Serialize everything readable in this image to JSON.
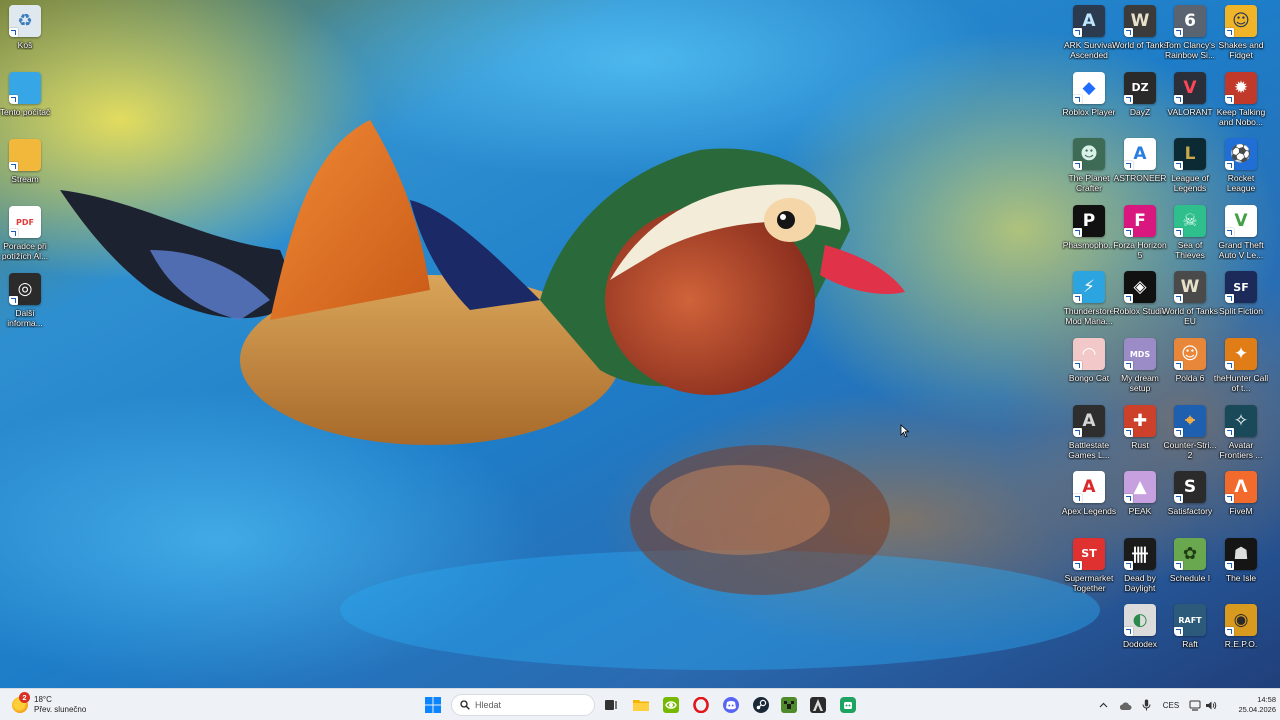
{
  "desktop": {
    "left_icons": [
      {
        "id": "recycle-bin",
        "label": "Koš",
        "icon": "recycle-bin-icon",
        "bg": "#dfe8ee",
        "glyph": "♻",
        "fg": "#3b7bbf"
      },
      {
        "id": "this-pc",
        "label": "Tento počítač",
        "icon": "monitor-icon",
        "bg": "#37a6e6",
        "glyph": "",
        "fg": "#ffffff"
      },
      {
        "id": "stream",
        "label": "Stream",
        "icon": "folder-icon",
        "bg": "#f1b83b",
        "glyph": "",
        "fg": "#ffffff"
      },
      {
        "id": "pdf",
        "label": "Poradce při potížích Al...",
        "icon": "pdf-icon",
        "bg": "#ffffff",
        "glyph": "PDF",
        "fg": "#e23c3c"
      },
      {
        "id": "more-info",
        "label": "Další informa...",
        "icon": "chrome-icon",
        "bg": "#2b2b2b",
        "glyph": "◎",
        "fg": "#ffffff"
      }
    ],
    "grid_icons": [
      {
        "id": "ark",
        "label": "ARK Survival Ascended",
        "icon": "ark-icon",
        "bg": "#2c3a4f",
        "glyph": "A",
        "fg": "#bde6ff"
      },
      {
        "id": "wot",
        "label": "World of Tanks",
        "icon": "world-of-tanks-icon",
        "bg": "#3b3b3b",
        "glyph": "W",
        "fg": "#e8e0c8"
      },
      {
        "id": "rainbow",
        "label": "Tom Clancy's Rainbow Si...",
        "icon": "rainbow-six-icon",
        "bg": "#5a6470",
        "glyph": "6",
        "fg": "#ffffff"
      },
      {
        "id": "shakes",
        "label": "Shakes and Fidget",
        "icon": "shakes-fidget-icon",
        "bg": "#f0b428",
        "glyph": "☺",
        "fg": "#20345a"
      },
      {
        "id": "roblox-player",
        "label": "Roblox Player",
        "icon": "roblox-player-icon",
        "bg": "#ffffff",
        "glyph": "◆",
        "fg": "#1f6cff"
      },
      {
        "id": "dayz",
        "label": "DayZ",
        "icon": "dayz-icon",
        "bg": "#2a2a2a",
        "glyph": "DZ",
        "fg": "#ffffff"
      },
      {
        "id": "valorant",
        "label": "VALORANT",
        "icon": "valorant-icon",
        "bg": "#2b2f3a",
        "glyph": "V",
        "fg": "#ff4655"
      },
      {
        "id": "ktane",
        "label": "Keep Talking and Nobo...",
        "icon": "keep-talking-icon",
        "bg": "#c0392b",
        "glyph": "✹",
        "fg": "#ffffff"
      },
      {
        "id": "planet-crafter",
        "label": "The Planet Crafter",
        "icon": "planet-crafter-icon",
        "bg": "#3d6b55",
        "glyph": "☻",
        "fg": "#d9f0e8"
      },
      {
        "id": "astroneer",
        "label": "ASTRONEER",
        "icon": "astroneer-icon",
        "bg": "#ffffff",
        "glyph": "A",
        "fg": "#2a7de1"
      },
      {
        "id": "lol",
        "label": "League of Legends",
        "icon": "league-of-legends-icon",
        "bg": "#0b2a33",
        "glyph": "L",
        "fg": "#c8a84b"
      },
      {
        "id": "rocket",
        "label": "Rocket League",
        "icon": "rocket-league-icon",
        "bg": "#1f6fd6",
        "glyph": "⚽",
        "fg": "#ffffff"
      },
      {
        "id": "phasmo",
        "label": "Phasmopho...",
        "icon": "phasmophobia-icon",
        "bg": "#111111",
        "glyph": "P",
        "fg": "#ffffff"
      },
      {
        "id": "forza",
        "label": "Forza Horizon 5",
        "icon": "forza-icon",
        "bg": "#d8187e",
        "glyph": "F",
        "fg": "#ffffff"
      },
      {
        "id": "sea",
        "label": "Sea of Thieves",
        "icon": "sea-of-thieves-icon",
        "bg": "#2fbf8c",
        "glyph": "☠",
        "fg": "#e8fff4"
      },
      {
        "id": "gta",
        "label": "Grand Theft Auto V Le...",
        "icon": "gta-icon",
        "bg": "#ffffff",
        "glyph": "V",
        "fg": "#43a047"
      },
      {
        "id": "thunderstore",
        "label": "Thunderstore Mod Mana...",
        "icon": "thunderstore-icon",
        "bg": "#2ca4e0",
        "glyph": "⚡",
        "fg": "#ffffff"
      },
      {
        "id": "roblox-studio",
        "label": "Roblox Studio",
        "icon": "roblox-studio-icon",
        "bg": "#111111",
        "glyph": "◈",
        "fg": "#ffffff"
      },
      {
        "id": "wot-eu",
        "label": "World of Tanks EU",
        "icon": "world-of-tanks-eu-icon",
        "bg": "#4a4a4a",
        "glyph": "W",
        "fg": "#e8e0c8"
      },
      {
        "id": "split",
        "label": "Split Fiction",
        "icon": "split-fiction-icon",
        "bg": "#1c2a5a",
        "glyph": "SF",
        "fg": "#ffffff"
      },
      {
        "id": "bongo",
        "label": "Bongo Cat",
        "icon": "bongo-cat-icon",
        "bg": "#f3c8c8",
        "glyph": "◠",
        "fg": "#ffffff"
      },
      {
        "id": "mds",
        "label": "My dream setup",
        "icon": "my-dream-setup-icon",
        "bg": "#9b8cc8",
        "glyph": "MDS",
        "fg": "#ffffff"
      },
      {
        "id": "polda",
        "label": "Polda 6",
        "icon": "polda-icon",
        "bg": "#e8873a",
        "glyph": "☺",
        "fg": "#ffffff"
      },
      {
        "id": "thehunter",
        "label": "theHunter Call of t...",
        "icon": "thehunter-icon",
        "bg": "#e07d17",
        "glyph": "✦",
        "fg": "#ffffff"
      },
      {
        "id": "battlestate",
        "label": "Battlestate Games L...",
        "icon": "battlestate-icon",
        "bg": "#2e2e2e",
        "glyph": "A",
        "fg": "#d6d6d6"
      },
      {
        "id": "rust",
        "label": "Rust",
        "icon": "rust-icon",
        "bg": "#cd412b",
        "glyph": "✚",
        "fg": "#ffffff"
      },
      {
        "id": "cs2",
        "label": "Counter-Stri... 2",
        "icon": "counter-strike-icon",
        "bg": "#1f5fb0",
        "glyph": "⌖",
        "fg": "#ffb13b"
      },
      {
        "id": "avatar",
        "label": "Avatar Frontiers ...",
        "icon": "avatar-frontiers-icon",
        "bg": "#1a4a5a",
        "glyph": "✧",
        "fg": "#ffffff"
      },
      {
        "id": "apex",
        "label": "Apex Legends",
        "icon": "apex-icon",
        "bg": "#ffffff",
        "glyph": "A",
        "fg": "#da292a"
      },
      {
        "id": "peak",
        "label": "PEAK",
        "icon": "peak-icon",
        "bg": "#c7a0e0",
        "glyph": "▲",
        "fg": "#ffffff"
      },
      {
        "id": "satisfactory",
        "label": "Satisfactory",
        "icon": "satisfactory-icon",
        "bg": "#2b2b2b",
        "glyph": "S",
        "fg": "#ffffff"
      },
      {
        "id": "fivem",
        "label": "FiveM",
        "icon": "fivem-icon",
        "bg": "#f26b2c",
        "glyph": "Λ",
        "fg": "#ffffff"
      },
      {
        "id": "supermarket",
        "label": "Supermarket Together",
        "icon": "supermarket-icon",
        "bg": "#e03131",
        "glyph": "ST",
        "fg": "#ffffff"
      },
      {
        "id": "dbd",
        "label": "Dead by Daylight",
        "icon": "dead-by-daylight-icon",
        "bg": "#1b1b1b",
        "glyph": "卌",
        "fg": "#ffffff"
      },
      {
        "id": "schedule",
        "label": "Schedule I",
        "icon": "schedule-i-icon",
        "bg": "#6aa84f",
        "glyph": "✿",
        "fg": "#1e3d12"
      },
      {
        "id": "isle",
        "label": "The Isle",
        "icon": "the-isle-icon",
        "bg": "#151515",
        "glyph": "☗",
        "fg": "#dddddd"
      },
      {
        "id": "dododex",
        "label": "Dododex",
        "icon": "dododex-icon",
        "bg": "#dcdcdc",
        "glyph": "◐",
        "fg": "#2a8a4a"
      },
      {
        "id": "raft",
        "label": "Raft",
        "icon": "raft-icon",
        "bg": "#2c5a7a",
        "glyph": "RAFT",
        "fg": "#ffffff"
      },
      {
        "id": "repo",
        "label": "R.E.P.O.",
        "icon": "repo-icon",
        "bg": "#d89a1f",
        "glyph": "◉",
        "fg": "#2a2a2a"
      }
    ]
  },
  "taskbar": {
    "weather": {
      "temp": "18°C",
      "desc": "Přev. slunečno",
      "badge": "2"
    },
    "search": {
      "placeholder": "Hledat"
    },
    "apps": [
      {
        "id": "start",
        "icon": "windows-start-icon",
        "color": "#0a84ff"
      },
      {
        "id": "taskview",
        "icon": "task-view-icon",
        "color": "#333333"
      },
      {
        "id": "explorer",
        "icon": "file-explorer-icon",
        "color": "#f4b400"
      },
      {
        "id": "nvidia",
        "icon": "nvidia-icon",
        "color": "#76b900"
      },
      {
        "id": "opera",
        "icon": "opera-icon",
        "color": "#e0161b"
      },
      {
        "id": "discord",
        "icon": "discord-icon",
        "color": "#5865f2"
      },
      {
        "id": "steam",
        "icon": "steam-icon",
        "color": "#1b2838"
      },
      {
        "id": "minecraft",
        "icon": "minecraft-icon",
        "color": "#4f8a2b"
      },
      {
        "id": "unknown",
        "icon": "app-icon",
        "color": "#2b2b2b"
      },
      {
        "id": "xbox",
        "icon": "xbox-icon",
        "color": "#1ea362"
      }
    ],
    "tray": {
      "language": "CES",
      "time": "14:58",
      "date": "25.04.2026"
    }
  },
  "colors": {
    "taskbar_bg": "#eef1f6",
    "accent": "#0a84ff"
  }
}
